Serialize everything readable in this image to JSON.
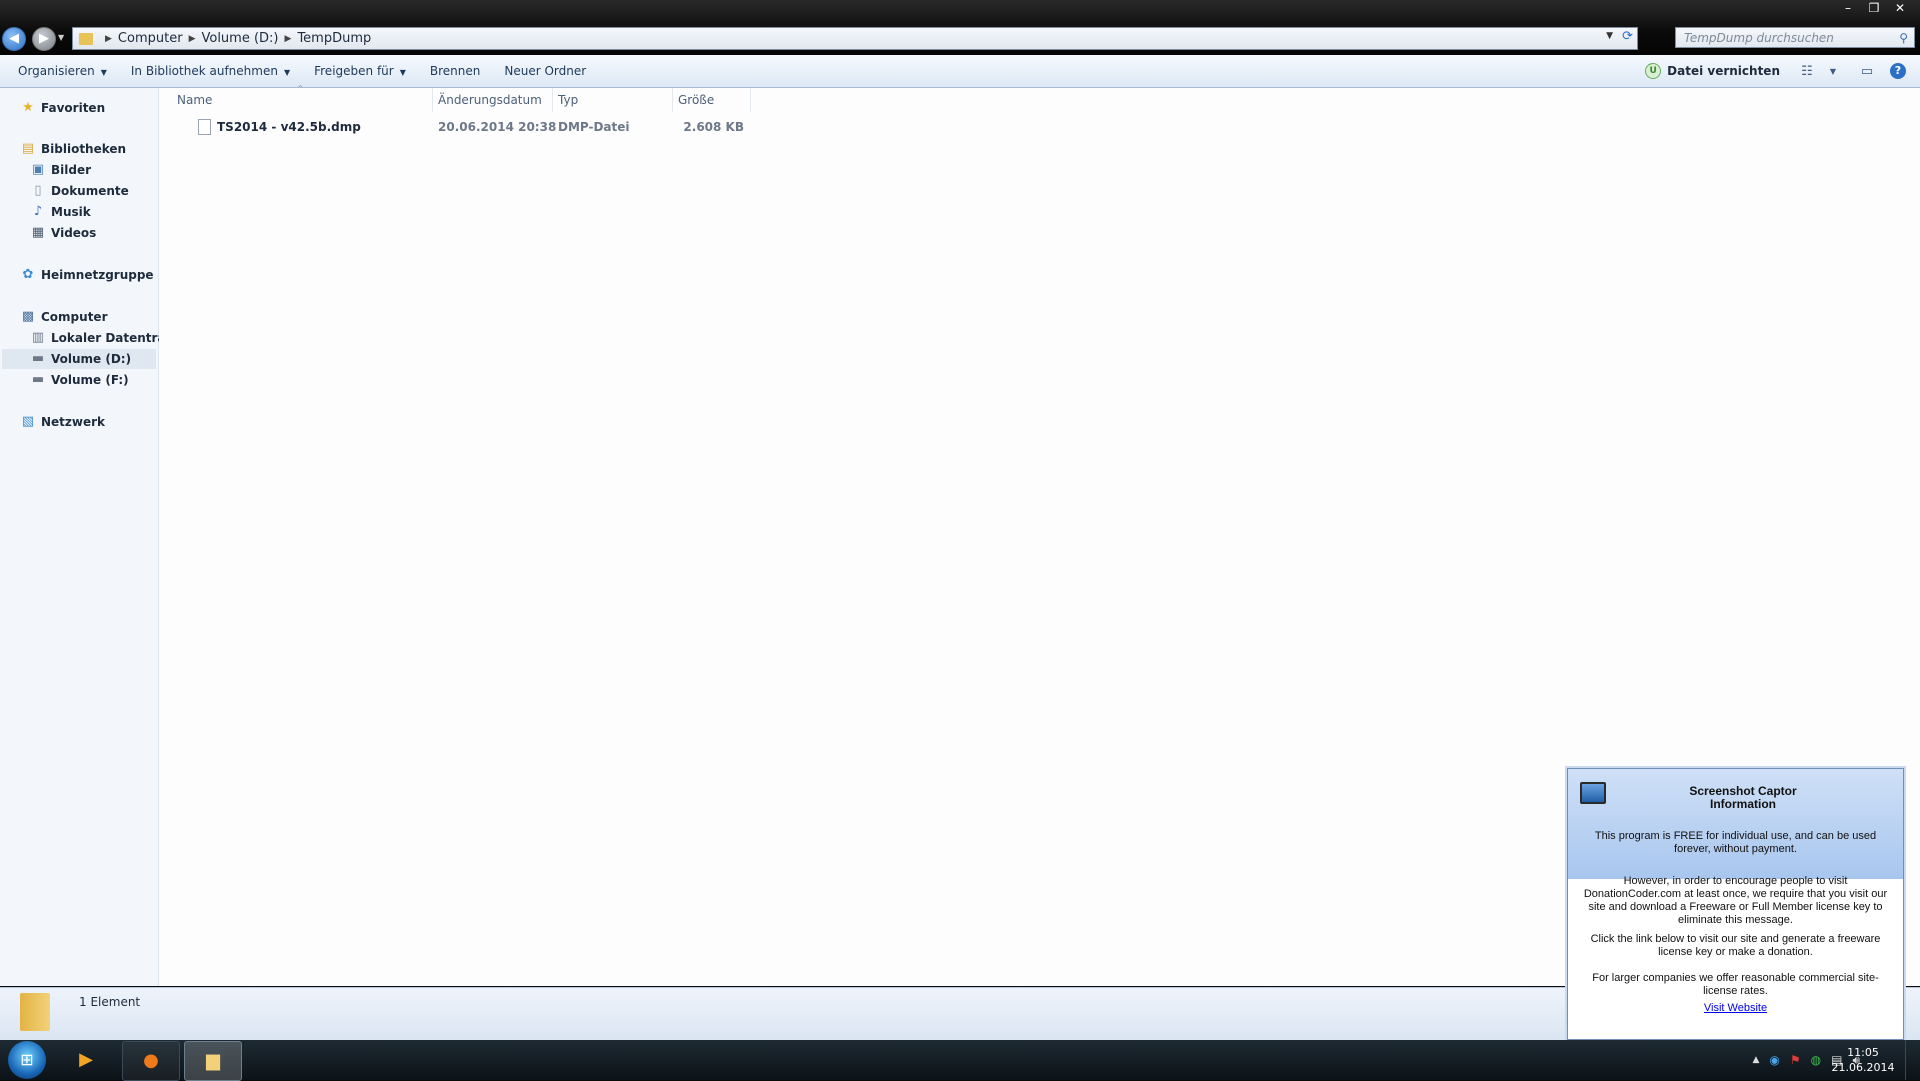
{
  "window": {
    "controls": {
      "minimize": "–",
      "maximize": "❐",
      "close": "✕"
    }
  },
  "address": {
    "crumbs": [
      "Computer",
      "Volume (D:)",
      "TempDump"
    ]
  },
  "search": {
    "placeholder": "TempDump durchsuchen"
  },
  "toolbar": {
    "organize": "Organisieren",
    "include_library": "In Bibliothek aufnehmen",
    "share_with": "Freigeben für",
    "burn": "Brennen",
    "new_folder": "Neuer Ordner",
    "shred": "Datei vernichten"
  },
  "nav": {
    "favorites": "Favoriten",
    "libraries": "Bibliotheken",
    "pictures": "Bilder",
    "documents": "Dokumente",
    "music": "Musik",
    "videos": "Videos",
    "homegroup": "Heimnetzgruppe",
    "computer": "Computer",
    "local_disk": "Lokaler Datenträger",
    "volume_d": "Volume (D:)",
    "volume_f": "Volume (F:)",
    "network": "Netzwerk"
  },
  "columns": {
    "name": "Name",
    "date": "Änderungsdatum",
    "type": "Typ",
    "size": "Größe"
  },
  "files": [
    {
      "name": "TS2014 - v42.5b.dmp",
      "date": "20.06.2014 20:38",
      "type": "DMP-Datei",
      "size": "2.608 KB"
    }
  ],
  "status": {
    "count": "1 Element"
  },
  "popup": {
    "title_line1": "Screenshot Captor",
    "title_line2": "Information",
    "p1": "This program is FREE for individual use, and can be used forever, without payment.",
    "p2": "However, in order to encourage people to visit DonationCoder.com at least once, we require that you visit our site and download a Freeware or Full Member license key to eliminate this message.",
    "p3": "Click the link below to visit our site and generate a freeware license key or make a donation.",
    "p4": "For larger companies we offer reasonable commercial site-license rates.",
    "link": "Visit Website"
  },
  "taskbar": {
    "time": "11:05",
    "date": "21.06.2014"
  }
}
